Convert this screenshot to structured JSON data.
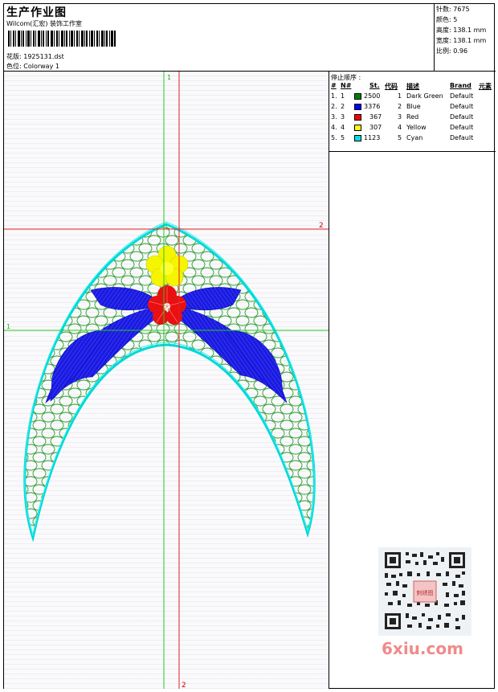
{
  "header": {
    "title": "生产作业图",
    "company": "Wilcom(汇宏) 装饰工作室",
    "design_label": "花版: 1925131.dst",
    "colorway_label": "色位: Colorway 1"
  },
  "stats": {
    "stitches": "针数: 7675",
    "colors": "颜色: 5",
    "height": "高度: 138.1 mm",
    "width": "宽度: 138.1 mm",
    "scale": "比例: 0.96"
  },
  "sequence": {
    "title": "停止顺序 :",
    "headers": {
      "num": "#",
      "no": "N#",
      "st": "St.",
      "code": "代码",
      "desc": "描述",
      "brand": "Brand",
      "elem": "元素"
    },
    "rows": [
      {
        "num": "1.",
        "no": "1",
        "color": "#008000",
        "st": "2500",
        "code": "1",
        "desc": "Dark Green",
        "brand": "Default"
      },
      {
        "num": "2.",
        "no": "2",
        "color": "#0000ff",
        "st": "3376",
        "code": "2",
        "desc": "Blue",
        "brand": "Default"
      },
      {
        "num": "3.",
        "no": "3",
        "color": "#ff0000",
        "st": "367",
        "code": "3",
        "desc": "Red",
        "brand": "Default"
      },
      {
        "num": "4.",
        "no": "4",
        "color": "#ffff00",
        "st": "307",
        "code": "4",
        "desc": "Yellow",
        "brand": "Default"
      },
      {
        "num": "5.",
        "no": "5",
        "color": "#00e0e0",
        "st": "1123",
        "code": "5",
        "desc": "Cyan",
        "brand": "Default"
      }
    ]
  },
  "guides": {
    "green_v": "1",
    "green_h": "1",
    "red_h": "2",
    "red_v": "2"
  },
  "watermark": "6xiu.com",
  "qr_badge": "刺绣图"
}
